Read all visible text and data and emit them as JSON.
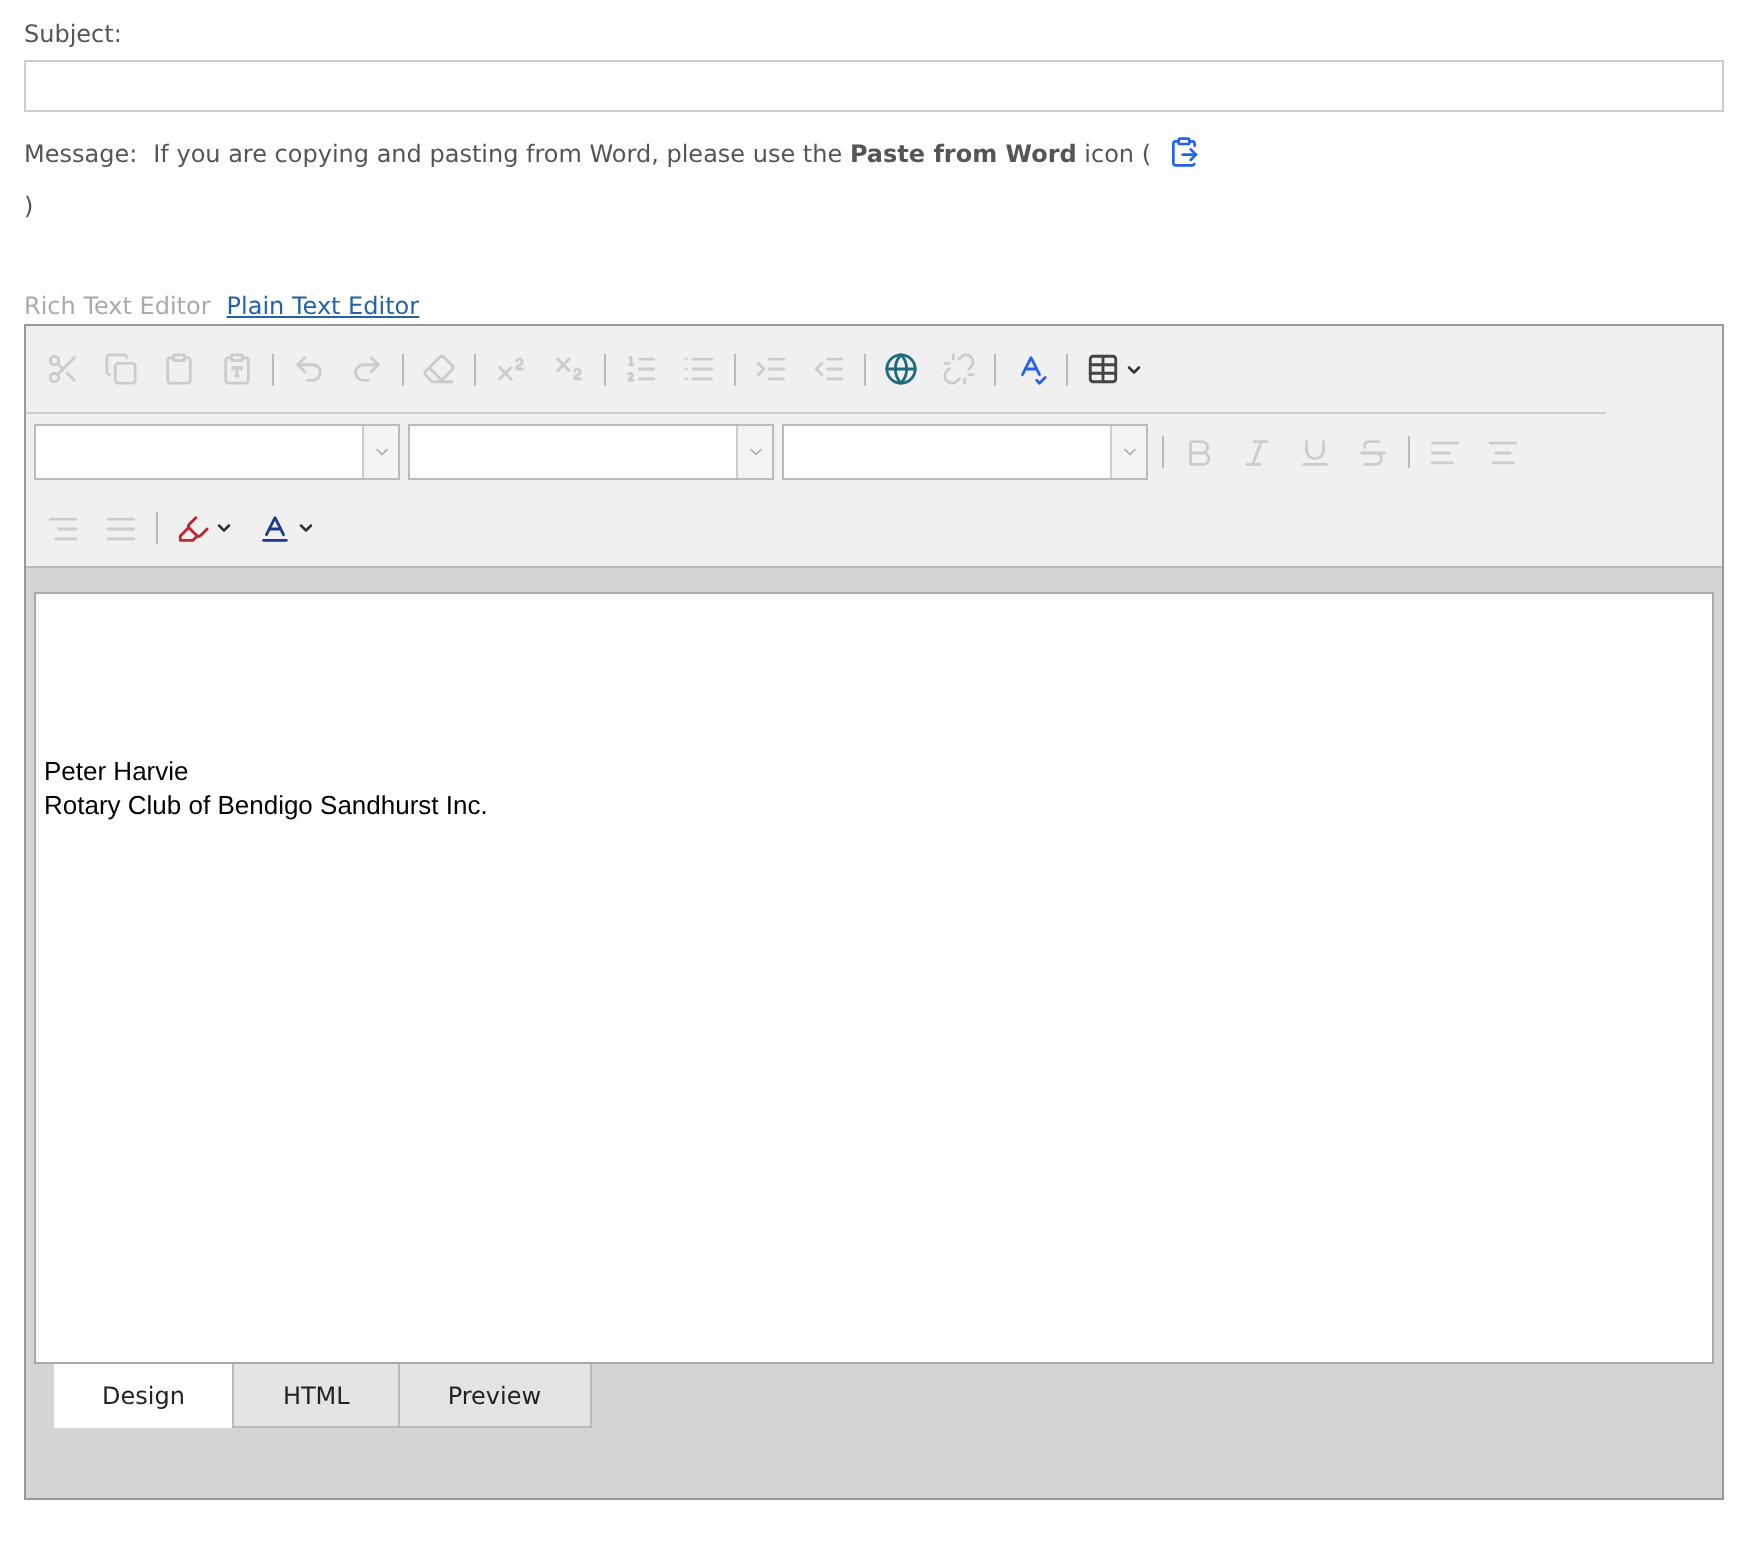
{
  "subject": {
    "label": "Subject:"
  },
  "message": {
    "label": "Message:",
    "note": "If you are copying and pasting from Word, please use the **Paste from Word** icon (",
    "note_end": ")"
  },
  "editor_modes": [
    {
      "label": "Rich Text Editor",
      "selected": true
    },
    {
      "label": "Plain Text Editor",
      "selected": false
    }
  ],
  "toolbar_rows": [
    [
      {
        "kind": "button",
        "disabled": true
      },
      {
        "kind": "button",
        "disabled": true
      },
      {
        "kind": "button",
        "disabled": true
      },
      {
        "kind": "button",
        "disabled": true
      },
      {
        "kind": "separator"
      },
      {
        "kind": "button",
        "disabled": true
      },
      {
        "kind": "button",
        "disabled": true
      },
      {
        "kind": "separator"
      },
      {
        "kind": "button",
        "disabled": true
      },
      {
        "kind": "separator"
      },
      {
        "kind": "button",
        "disabled": true
      },
      {
        "kind": "button",
        "disabled": true
      },
      {
        "kind": "separator"
      },
      {
        "kind": "button",
        "disabled": true
      },
      {
        "kind": "button",
        "disabled": true
      },
      {
        "kind": "separator"
      },
      {
        "kind": "button",
        "disabled": true
      },
      {
        "kind": "button",
        "disabled": true
      },
      {
        "kind": "separator"
      },
      {
        "kind": "button",
        "disabled": false
      },
      {
        "kind": "button",
        "disabled": true
      },
      {
        "kind": "separator"
      },
      {
        "kind": "button",
        "disabled": false
      },
      {
        "kind": "separator"
      },
      {
        "kind": "dropdown",
        "disabled": false
      }
    ],
    [
      {
        "kind": "select"
      },
      {
        "kind": "select"
      },
      {
        "kind": "select"
      },
      {
        "kind": "separator"
      },
      {
        "kind": "button",
        "disabled": true
      },
      {
        "kind": "button",
        "disabled": true
      },
      {
        "kind": "button",
        "disabled": true
      },
      {
        "kind": "button",
        "disabled": true
      },
      {
        "kind": "separator"
      },
      {
        "kind": "button",
        "disabled": true
      },
      {
        "kind": "button",
        "disabled": true
      }
    ],
    [
      {
        "kind": "button",
        "disabled": true
      },
      {
        "kind": "button",
        "disabled": true
      },
      {
        "kind": "separator"
      },
      {
        "kind": "dropdown",
        "disabled": false
      },
      {
        "kind": "dropdown",
        "disabled": false
      }
    ]
  ],
  "content_lines": [
    "Peter Harvie",
    "Rotary Club of Bendigo Sandhurst Inc."
  ],
  "view_tabs": [
    {
      "label": "Design",
      "selected": true
    },
    {
      "label": "HTML",
      "selected": false
    },
    {
      "label": "Preview",
      "selected": false
    }
  ]
}
